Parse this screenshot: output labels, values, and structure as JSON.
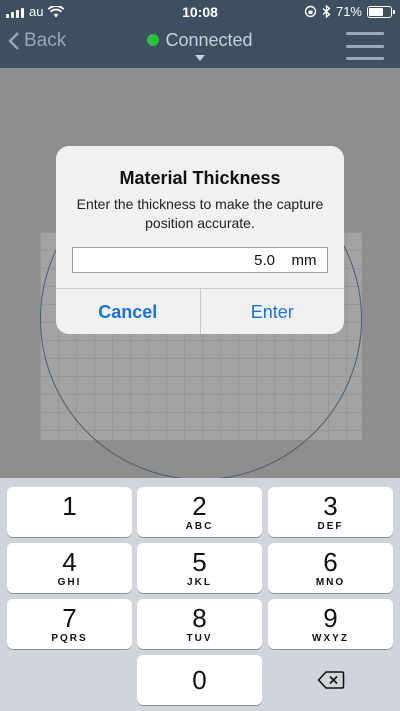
{
  "status_bar": {
    "carrier": "au",
    "time": "10:08",
    "battery_pct": "71%",
    "battery_level": 0.71
  },
  "nav": {
    "back_label": "Back",
    "title": "Connected",
    "status_color": "#2fbf3a"
  },
  "dialog": {
    "title": "Material Thickness",
    "message": "Enter the thickness to make the capture position accurate.",
    "input_value": "5.0",
    "unit": "mm",
    "cancel_label": "Cancel",
    "enter_label": "Enter",
    "accent_color": "#1a73d9"
  },
  "keypad": {
    "keys": [
      {
        "num": "1",
        "letters": ""
      },
      {
        "num": "2",
        "letters": "ABC"
      },
      {
        "num": "3",
        "letters": "DEF"
      },
      {
        "num": "4",
        "letters": "GHI"
      },
      {
        "num": "5",
        "letters": "JKL"
      },
      {
        "num": "6",
        "letters": "MNO"
      },
      {
        "num": "7",
        "letters": "PQRS"
      },
      {
        "num": "8",
        "letters": "TUV"
      },
      {
        "num": "9",
        "letters": "WXYZ"
      },
      {
        "num": "0",
        "letters": ""
      }
    ],
    "delete_icon": "backspace-icon"
  }
}
